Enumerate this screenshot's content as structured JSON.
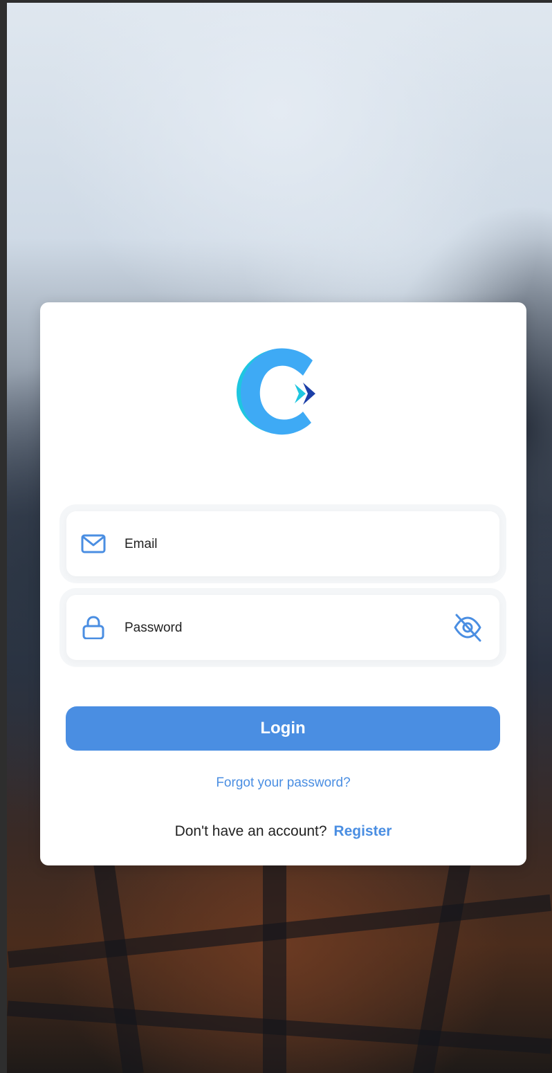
{
  "login_card": {
    "email": {
      "placeholder": "Email",
      "value": "",
      "icon": "mail-icon"
    },
    "password": {
      "placeholder": "Password",
      "value": "",
      "icon": "lock-icon",
      "toggle_icon": "eye-off-icon"
    },
    "login_label": "Login",
    "forgot_label": "Forgot your password?",
    "no_account_text": "Don't have an account?",
    "register_label": "Register"
  },
  "colors": {
    "accent": "#4a8ee2",
    "logo_cyan": "#1fc6e0",
    "logo_light_blue": "#3eaaf5",
    "logo_dark_blue": "#1b3fa8",
    "card_background": "#ffffff"
  }
}
